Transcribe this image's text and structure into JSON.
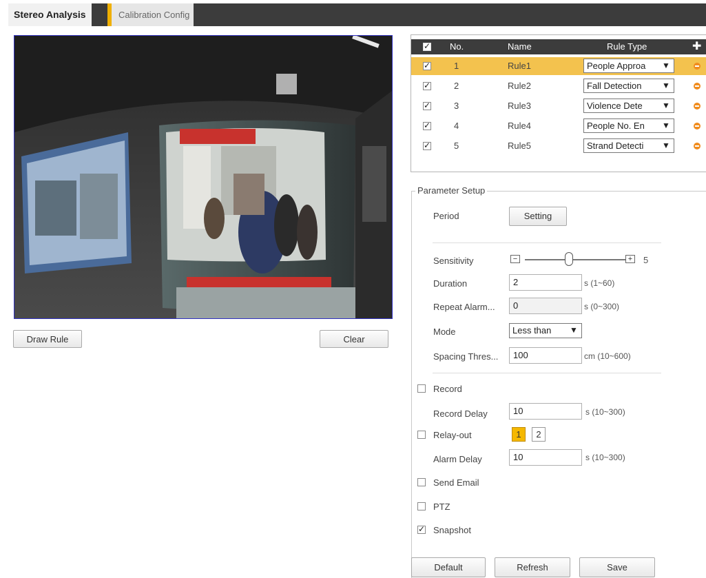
{
  "tabs": [
    {
      "label": "Stereo Analysis",
      "active": true
    },
    {
      "label": "Calibration Config",
      "active": false
    }
  ],
  "video": {
    "draw_rule_label": "Draw Rule",
    "clear_label": "Clear"
  },
  "rule_table": {
    "headers": {
      "no": "No.",
      "name": "Name",
      "rule_type": "Rule Type"
    },
    "add_icon": "plus-icon",
    "rows": [
      {
        "checked": true,
        "no": "1",
        "name": "Rule1",
        "rule_type": "People Approa",
        "selected": true
      },
      {
        "checked": true,
        "no": "2",
        "name": "Rule2",
        "rule_type": "Fall Detection",
        "selected": false
      },
      {
        "checked": true,
        "no": "3",
        "name": "Rule3",
        "rule_type": "Violence Dete",
        "selected": false
      },
      {
        "checked": true,
        "no": "4",
        "name": "Rule4",
        "rule_type": "People No. En",
        "selected": false
      },
      {
        "checked": true,
        "no": "5",
        "name": "Rule5",
        "rule_type": "Strand Detecti",
        "selected": false
      }
    ]
  },
  "param": {
    "legend": "Parameter Setup",
    "period_label": "Period",
    "setting_button": "Setting",
    "sensitivity_label": "Sensitivity",
    "sensitivity_value": "5",
    "sensitivity_level": 0.5,
    "duration_label": "Duration",
    "duration_value": "2",
    "duration_unit": "s (1~60)",
    "repeat_label": "Repeat Alarm...",
    "repeat_value": "0",
    "repeat_unit": "s (0~300)",
    "mode_label": "Mode",
    "mode_value": "Less than",
    "spacing_label": "Spacing Thres...",
    "spacing_value": "100",
    "spacing_unit": "cm (10~600)",
    "record_label": "Record",
    "record_checked": false,
    "record_delay_label": "Record Delay",
    "record_delay_value": "10",
    "record_delay_unit": "s (10~300)",
    "relay_label": "Relay-out",
    "relay_checked": false,
    "relay_channels": [
      "1",
      "2"
    ],
    "alarm_delay_label": "Alarm Delay",
    "alarm_delay_value": "10",
    "alarm_delay_unit": "s (10~300)",
    "send_email_label": "Send Email",
    "send_email_checked": false,
    "ptz_label": "PTZ",
    "ptz_checked": false,
    "snapshot_label": "Snapshot",
    "snapshot_checked": true
  },
  "footer": {
    "default_label": "Default",
    "refresh_label": "Refresh",
    "save_label": "Save"
  },
  "colors": {
    "accent": "#f3c24e",
    "header_bg": "#3c3c3c",
    "delete_icon": "#f08c1e",
    "video_border": "#3030c0"
  }
}
